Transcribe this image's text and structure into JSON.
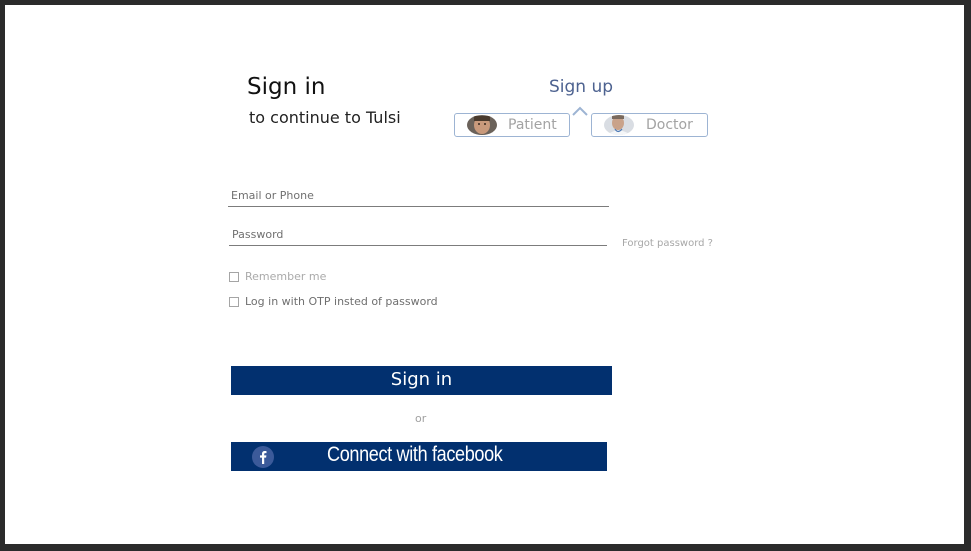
{
  "header": {
    "title": "Sign in",
    "subtitle": "to continue to Tulsi"
  },
  "signup": {
    "label": "Sign up",
    "roles": [
      {
        "label": "Patient",
        "icon": "patient-avatar-icon"
      },
      {
        "label": "Doctor",
        "icon": "doctor-avatar-icon"
      }
    ]
  },
  "form": {
    "email_placeholder": "Email or Phone",
    "password_placeholder": "Password",
    "forgot_label": "Forgot password ?",
    "remember_label": "Remember me",
    "otp_label": "Log in with OTP insted of password",
    "signin_label": "Sign in",
    "or_label": "or",
    "facebook_label": "Connect with facebook"
  },
  "colors": {
    "primary": "#02306f",
    "accent": "#4d6290",
    "role_border": "#9db4d3"
  }
}
